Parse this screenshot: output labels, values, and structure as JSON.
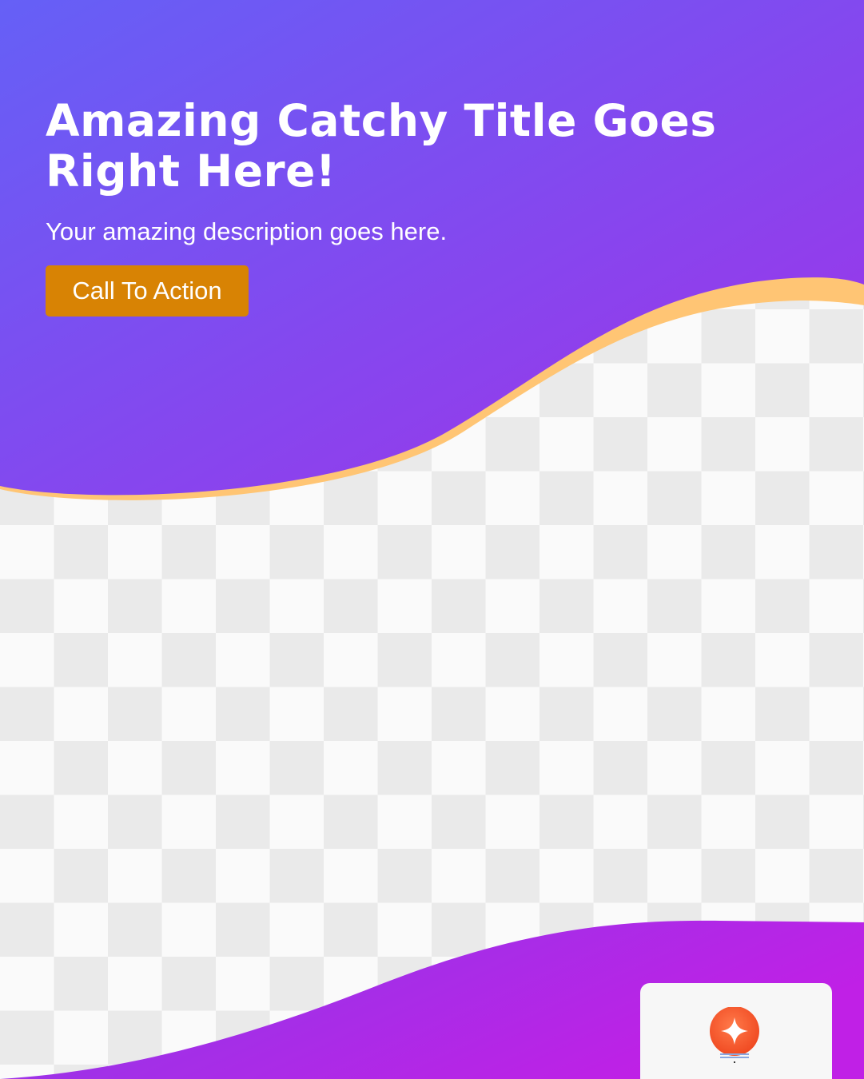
{
  "hero": {
    "title_line1": "Amazing Catchy Title Goes",
    "title_line2": "Right Here!",
    "description": "Your amazing description goes here.",
    "cta_label": "Call To Action"
  },
  "colors": {
    "gradient_start": "#6560f6",
    "gradient_end": "#a032e8",
    "bottom_gradient_start": "#8a3ce8",
    "bottom_gradient_end": "#c020e6",
    "accent_wave": "#ffc574",
    "cta_background": "#d88304",
    "logo_orange": "#ff5a2e"
  },
  "logo": {
    "icon": "sparkle-badge-icon"
  }
}
